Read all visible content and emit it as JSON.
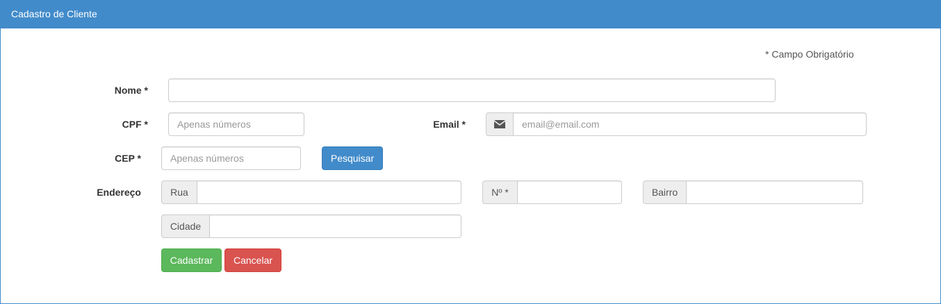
{
  "header": {
    "title": "Cadastro de Cliente"
  },
  "required_note": "* Campo Obrigatório",
  "fields": {
    "nome": {
      "label": "Nome *",
      "value": ""
    },
    "cpf": {
      "label": "CPF *",
      "placeholder": "Apenas números",
      "value": ""
    },
    "email": {
      "label": "Email *",
      "placeholder": "email@email.com",
      "icon": "envelope-icon"
    },
    "cep": {
      "label": "CEP *",
      "placeholder": "Apenas números"
    },
    "endereco": {
      "label": "Endereço"
    },
    "rua": {
      "addon": "Rua"
    },
    "numero": {
      "addon": "Nº *"
    },
    "bairro": {
      "addon": "Bairro"
    },
    "cidade": {
      "addon": "Cidade"
    }
  },
  "buttons": {
    "pesquisar": "Pesquisar",
    "cadastrar": "Cadastrar",
    "cancelar": "Cancelar"
  },
  "colors": {
    "primary": "#428bca",
    "success": "#5cb85c",
    "danger": "#d9534f"
  }
}
